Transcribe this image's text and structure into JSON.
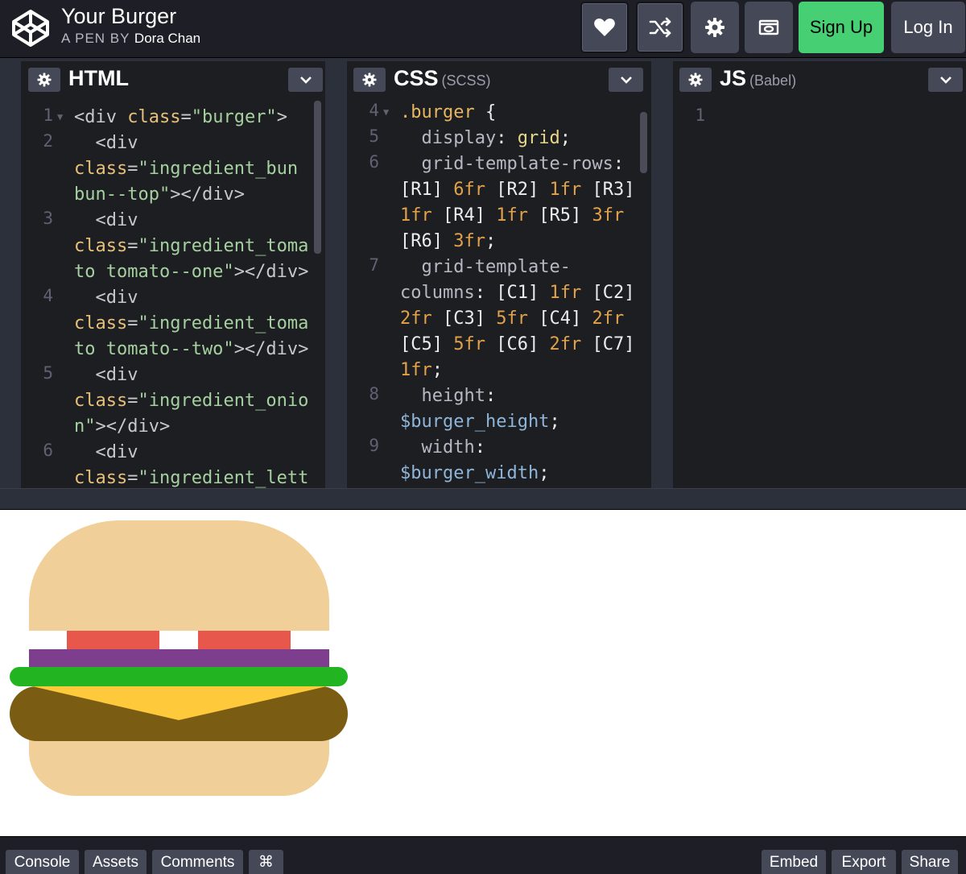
{
  "header": {
    "pen_title": "Your Burger",
    "byline_prefix": "A PEN BY",
    "author": "Dora Chan",
    "buttons": {
      "love_icon": "heart-icon",
      "fork_icon": "fork-icon",
      "settings_icon": "gear-icon",
      "view_icon": "view-mode-icon",
      "sign_up": "Sign Up",
      "log_in": "Log In"
    },
    "colors": {
      "sign_up_bg": "#47cf73",
      "button_bg": "#444857"
    }
  },
  "editors": {
    "html": {
      "title": "HTML",
      "subtitle": "",
      "line_numbers": [
        "1",
        "2",
        "3",
        "4",
        "5",
        "6"
      ],
      "lines": [
        {
          "parts": [
            [
              "<",
              "div"
            ],
            [
              "class",
              "=\"burger\">"
            ]
          ]
        },
        {
          "text_a": "  <div"
        },
        {
          "text_b": "class=\"ingredient_bun"
        },
        {
          "text_c": "bun--top\"></div>"
        },
        {
          "text_d": "  <div"
        },
        {
          "text_e": "class=\"ingredient_toma"
        },
        {
          "text_f": "to tomato--one\"></div>"
        },
        {
          "text_g": "  <div"
        },
        {
          "text_h": "class=\"ingredient_toma"
        },
        {
          "text_i": "to tomato--two\"></div>"
        },
        {
          "text_j": "  <div"
        },
        {
          "text_k": "class=\"ingredient_onio"
        },
        {
          "text_l": "n\"></div>"
        },
        {
          "text_m": "  <div"
        },
        {
          "text_n": "class=\"ingredient_lett"
        }
      ],
      "code": {
        "l1_open": "<div ",
        "l1_attr": "class",
        "l1_eq": "=",
        "l1_str": "\"burger\"",
        "l1_close": ">",
        "div_open": "<div",
        "class_attr": "class",
        "eq": "=",
        "bun_str_a": "\"ingredient_bun",
        "bun_str_b": "bun--top\"",
        "close_div": "></div>",
        "tom1_str_a": "\"ingredient_toma",
        "tom1_str_b": "to tomato--one\"",
        "tom2_str_a": "\"ingredient_toma",
        "tom2_str_b": "to tomato--two\"",
        "onion_str_a": "\"ingredient_onio",
        "onion_str_b": "n\"",
        "lett_str_a": "\"ingredient_lett"
      }
    },
    "css": {
      "title": "CSS",
      "subtitle": "(SCSS)",
      "line_numbers": [
        "4",
        "5",
        "6",
        "7",
        "8",
        "9"
      ],
      "code": {
        "selector": ".burger",
        "brace": " {",
        "display_prop": "display",
        "display_val": "grid",
        "rows_prop": "grid-template-rows",
        "r1": "[R1]",
        "r1v": "6fr",
        "r2": "[R2]",
        "r2v": "1fr",
        "r3": "[R3]",
        "r3v": "1fr",
        "r4": "[R4]",
        "r4v": "1fr",
        "r5": "[R5]",
        "r5v": "3fr",
        "r6": "[R6]",
        "r6v": "3fr",
        "cols_prop_a": "grid-template-",
        "cols_prop_b": "columns",
        "c1": "[C1]",
        "c1v": "1fr",
        "c2": "[C2]",
        "c2v": "2fr",
        "c3": "[C3]",
        "c3v": "5fr",
        "c4": "[C4]",
        "c4v": "2fr",
        "c5": "[C5]",
        "c5v": "5fr",
        "c6": "[C6]",
        "c6v": "2fr",
        "c7": "[C7]",
        "c7v": "1fr",
        "height_prop": "height",
        "height_val": "$burger_height",
        "width_prop": "width",
        "width_val": "$burger_width",
        "colon": ":",
        "semi": ";"
      }
    },
    "js": {
      "title": "JS",
      "subtitle": "(Babel)",
      "line_numbers": [
        "1"
      ]
    }
  },
  "preview": {
    "colors": {
      "bun": "#f0cf98",
      "tomato": "#e8574c",
      "onion": "#7d3f8d",
      "lettuce": "#22b521",
      "cheese": "#ffc93c",
      "patty": "#7a5c13"
    }
  },
  "footer": {
    "left": [
      "Console",
      "Assets",
      "Comments",
      "⌘"
    ],
    "right": [
      "Embed",
      "Export",
      "Share"
    ]
  }
}
